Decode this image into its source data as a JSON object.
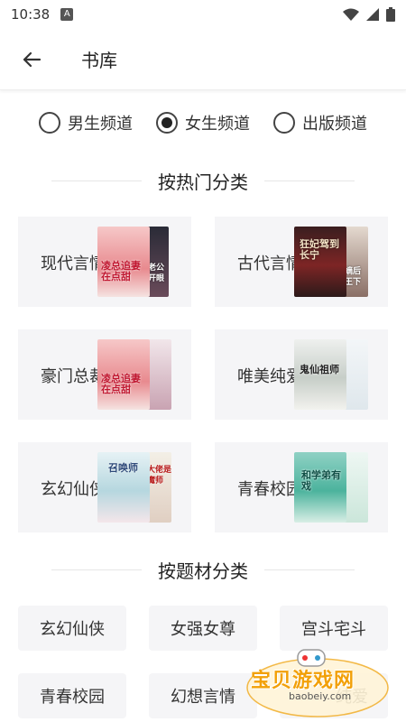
{
  "status_bar": {
    "time": "10:38",
    "notif_letter": "A"
  },
  "app_bar": {
    "title": "书库"
  },
  "channels": [
    {
      "label": "男生频道",
      "selected": false
    },
    {
      "label": "女生频道",
      "selected": true
    },
    {
      "label": "出版频道",
      "selected": false
    }
  ],
  "sections": {
    "by_popularity": "按热门分类",
    "by_theme": "按题材分类"
  },
  "categories": [
    {
      "label": "现代言情",
      "cover_text_1": "凌总追妻在点甜",
      "cover_text_2": "老公开眼"
    },
    {
      "label": "古代言情",
      "cover_text_1": "狂妃驾到长宁",
      "cover_text_2": "嫡后王下"
    },
    {
      "label": "豪门总裁",
      "cover_text_1": "凌总追妻在点甜",
      "cover_text_2": ""
    },
    {
      "label": "唯美纯爱",
      "cover_text_1": "鬼仙祖师",
      "cover_text_2": ""
    },
    {
      "label": "玄幻仙侠",
      "cover_text_1": "召唤师",
      "cover_text_2": "大佬是魔师"
    },
    {
      "label": "青春校园",
      "cover_text_1": "和学弟有戏",
      "cover_text_2": ""
    }
  ],
  "themes": [
    {
      "label": "玄幻仙侠"
    },
    {
      "label": "女强女尊"
    },
    {
      "label": "宫斗宅斗"
    },
    {
      "label": "青春校园"
    },
    {
      "label": "幻想言情"
    },
    {
      "label": "纯爱"
    }
  ],
  "watermark": {
    "text": "宝贝游戏网",
    "url": "baobeiy.com"
  },
  "colors": {
    "background": "#ffffff",
    "card": "#f5f5f7",
    "watermark": "#f2a007"
  }
}
